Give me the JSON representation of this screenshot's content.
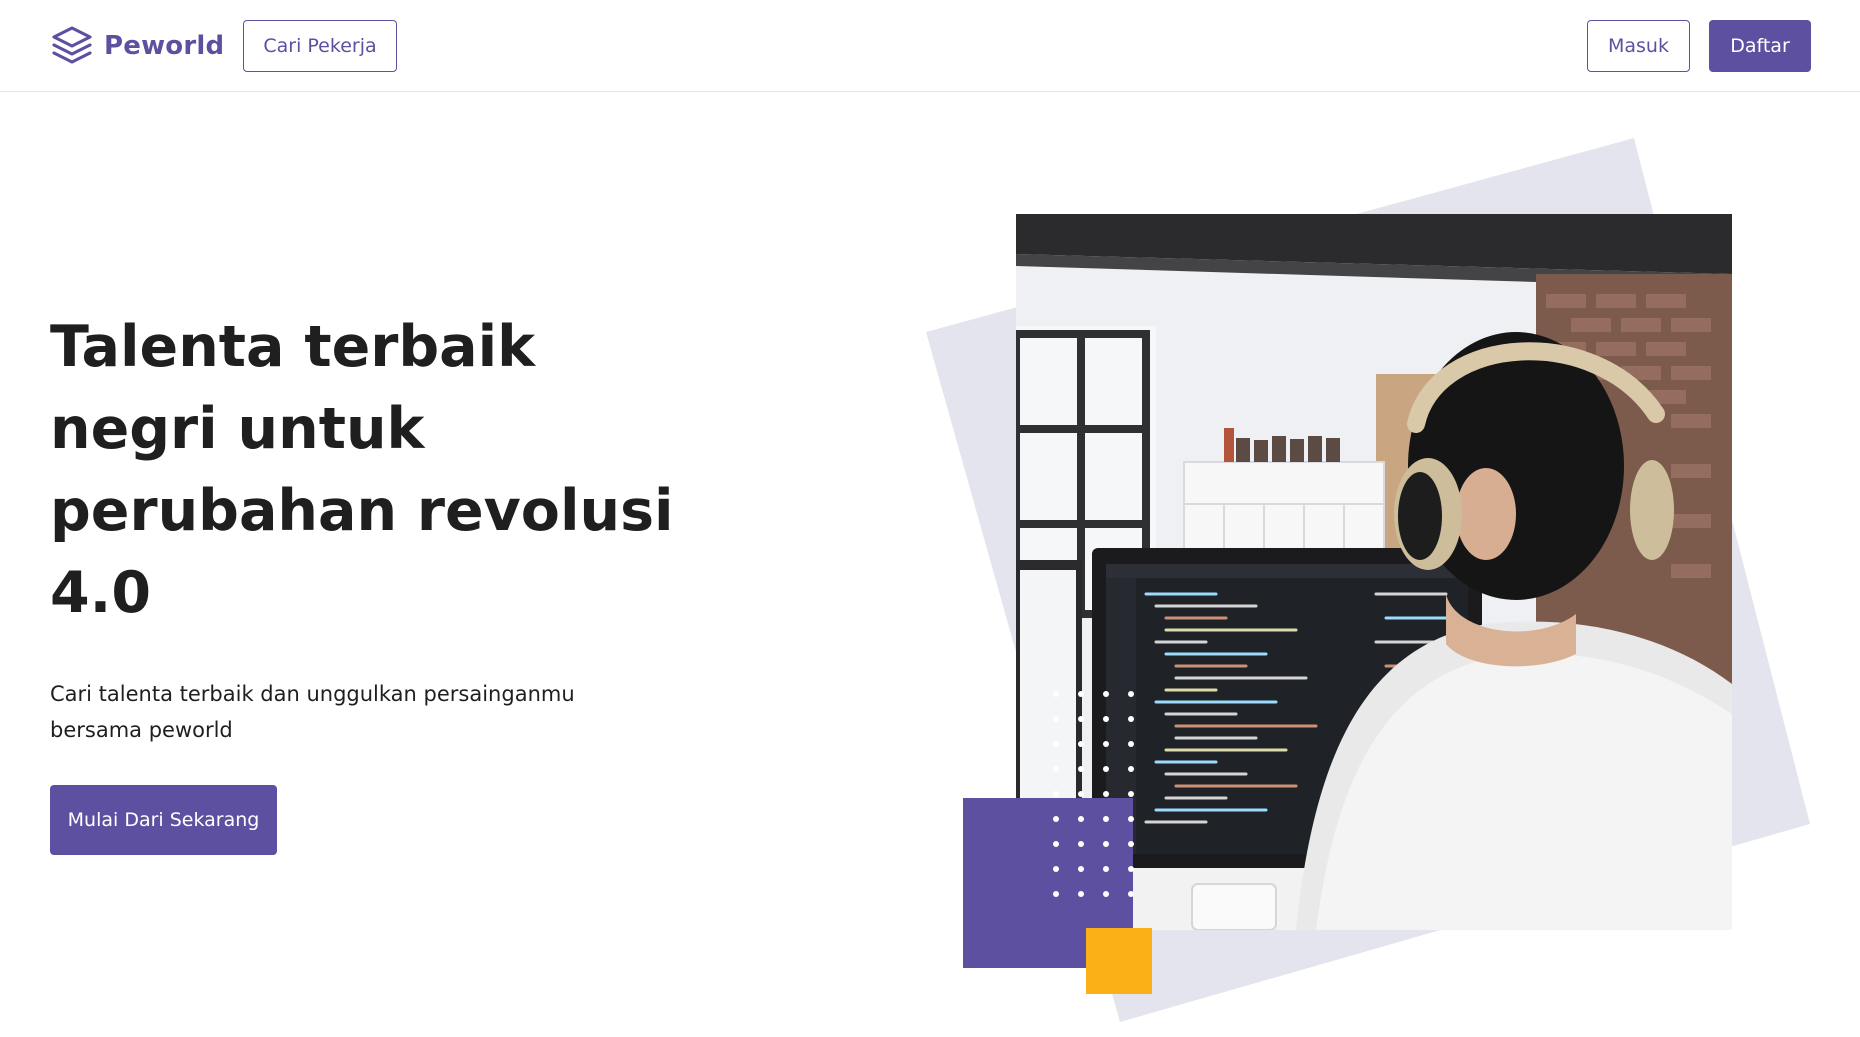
{
  "header": {
    "brand_name": "Peworld",
    "find_workers_label": "Cari Pekerja",
    "login_label": "Masuk",
    "register_label": "Daftar"
  },
  "hero": {
    "title": "Talenta terbaik negri untuk perubahan revolusi 4.0",
    "subtitle": "Cari talenta terbaik dan unggulkan persainganmu bersama peworld",
    "cta_label": "Mulai Dari Sekarang"
  },
  "icons": {
    "brand": "layers-stack-icon"
  },
  "colors": {
    "brand_purple": "#5e50a1",
    "accent_yellow": "#fbb017",
    "shape_gray": "#e4e4ee"
  }
}
